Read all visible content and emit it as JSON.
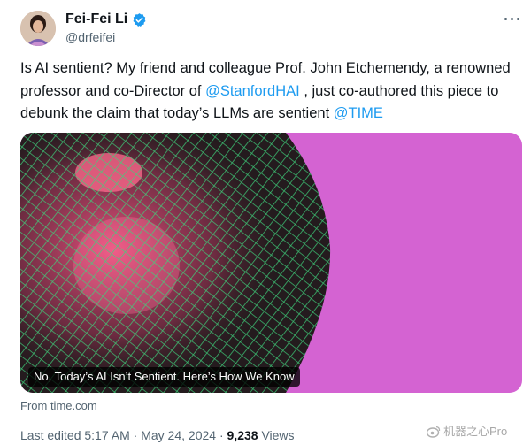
{
  "author": {
    "name": "Fei-Fei Li",
    "handle": "@drfeifei",
    "verified_icon": "verified-badge-icon"
  },
  "tweet": {
    "text_before_mention1": "Is AI sentient? My friend and colleague Prof. John Etchemendy, a renowned professor and co-Director of ",
    "mention1": "@StanfordHAI",
    "text_between": " , just co-authored this piece to debunk the claim that today’s LLMs are sentient ",
    "mention2": "@TIME"
  },
  "link_card": {
    "caption": "No, Today’s AI Isn’t Sentient. Here’s How We Know",
    "source": "From time.com"
  },
  "meta": {
    "edited": "Last edited 5:17 AM",
    "sep1": " · ",
    "date": "May 24, 2024",
    "sep2": " · ",
    "views_count": "9,238",
    "views_label": " Views"
  },
  "watermark": "机器之心Pro",
  "colors": {
    "link": "#1d9bf0",
    "verified": "#1d9bf0",
    "media_background": "#d65fd2",
    "net": "#3bd07a"
  }
}
